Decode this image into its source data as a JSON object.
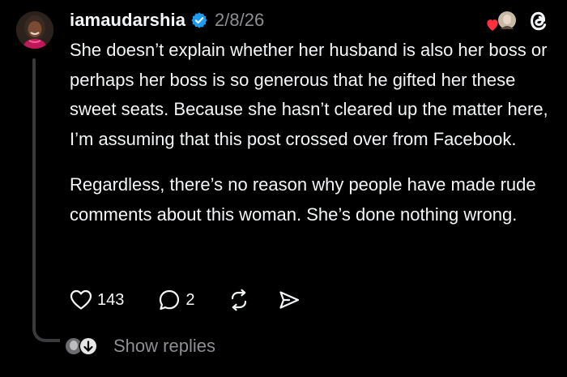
{
  "post": {
    "username": "iamaudarshia",
    "verified": true,
    "timestamp": "2/8/26",
    "paragraphs": [
      "She doesn’t explain whether her husband is also her boss or perhaps her boss is so generous that he gifted her these sweet seats. Because she hasn’t cleared up the matter here, I’m assuming that this post crossed over from Facebook.",
      "Regardless, there’s no reason why people have made rude comments about this woman. She’s done nothing wrong."
    ]
  },
  "actions": {
    "likes": "143",
    "comments": "2"
  },
  "replies": {
    "label": "Show replies"
  },
  "icons": {
    "verified": "verified-badge-icon",
    "like": "heart-icon",
    "comment": "comment-bubble-icon",
    "repost": "repost-icon",
    "share": "share-icon",
    "threads": "threads-logo-icon",
    "liked_by": "liked-by-heart-icon",
    "reply_more": "chevron-down-icon"
  },
  "colors": {
    "background": "#000000",
    "text": "#f3f5f7",
    "muted": "#8e8e93",
    "verified": "#1d9bf0",
    "like_heart": "#ff3040",
    "thread_line": "#3a3a3c"
  }
}
